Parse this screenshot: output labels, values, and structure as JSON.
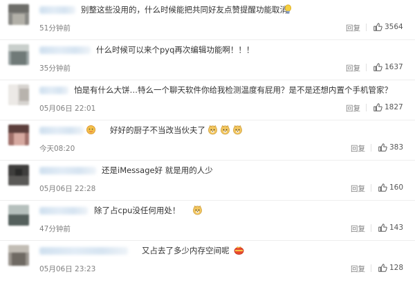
{
  "reply_label": "回复",
  "comments": [
    {
      "text": "别整这些没用的，什么时候能把共同好友点赞提醒功能取消",
      "time": "51分钟前",
      "likes": "3564",
      "emoji": "bulb-icon"
    },
    {
      "text": "什么时候可以来个pyq再次编辑功能啊！！！",
      "time": "35分钟前",
      "likes": "1637"
    },
    {
      "text": "怕是有什么大饼…特么一个聊天软件你给我检测温度有屁用？是不是还想内置个手机管家？",
      "time": "05月06日 22:01",
      "likes": "1827"
    },
    {
      "text": "好好的厨子不当改当伙夫了",
      "time": "今天08:20",
      "likes": "383",
      "emoji": "doge-icon",
      "emoji_count": 3
    },
    {
      "text": "还是iMessage好 就是用的人少",
      "time": "05月06日 22:28",
      "likes": "160"
    },
    {
      "text": "除了占cpu没任何用处！",
      "time": "47分钟前",
      "likes": "143",
      "emoji": "doge-icon",
      "emoji_count": 1
    },
    {
      "text": "又占去了多少内存空间呢",
      "time": "05月06日 23:23",
      "likes": "128",
      "emoji": "gift-icon"
    }
  ]
}
